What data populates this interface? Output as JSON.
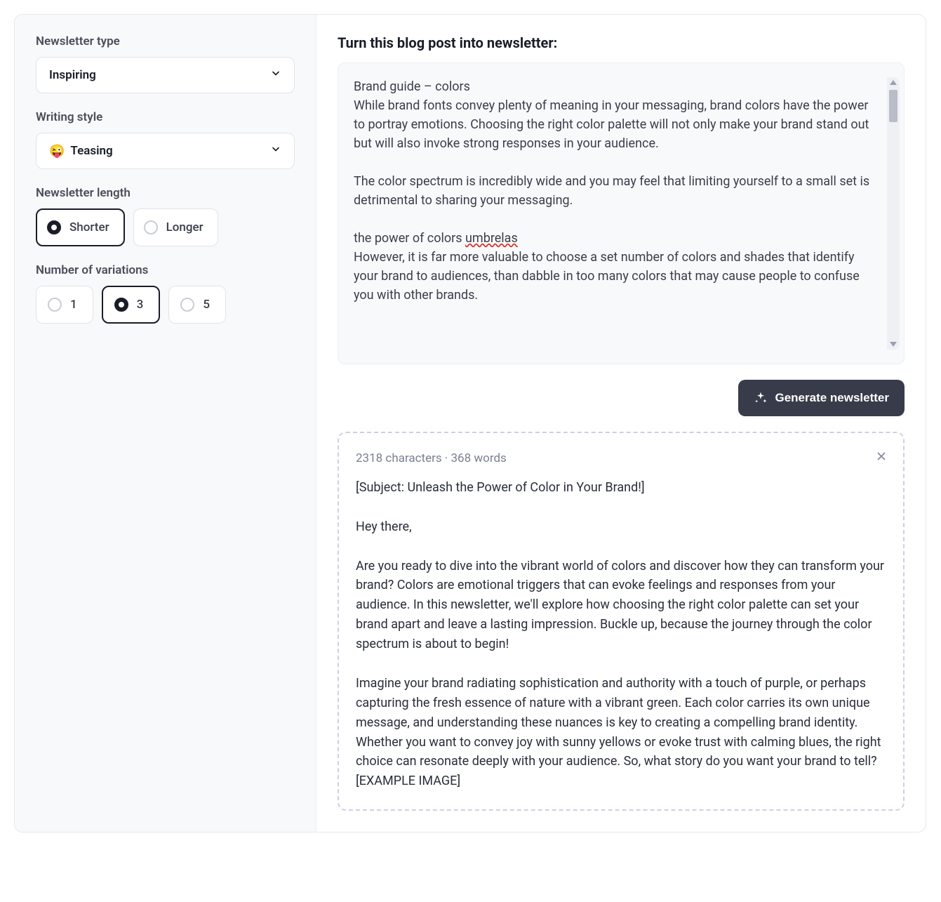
{
  "sidebar": {
    "type_label": "Newsletter type",
    "type_value": "Inspiring",
    "style_label": "Writing style",
    "style_emoji": "😜",
    "style_value": "Teasing",
    "length_label": "Newsletter length",
    "length_options": [
      "Shorter",
      "Longer"
    ],
    "length_selected": "Shorter",
    "variations_label": "Number of variations",
    "variations_options": [
      "1",
      "3",
      "5"
    ],
    "variations_selected": "3"
  },
  "main": {
    "title": "Turn this blog post into newsletter:",
    "input_text_pre": "Brand guide – colors\nWhile brand fonts convey plenty of meaning in your messaging, brand colors have the power to portray emotions. Choosing the right color palette will not only make your brand stand out but will also invoke strong responses in your audience.\n\nThe color spectrum is incredibly wide and you may feel that limiting yourself to a small set is detrimental to sharing your messaging.\n\nthe power of colors ",
    "input_spellerr": "umbrelas",
    "input_text_post": "\nHowever, it is far more valuable to choose a set number of colors and shades that identify your brand to audiences, than dabble in too many colors that may cause people to confuse you with other brands.",
    "generate_label": "Generate newsletter"
  },
  "output": {
    "meta": "2318 characters · 368 words",
    "body": "[Subject: Unleash the Power of Color in Your Brand!]\n\nHey there,\n\nAre you ready to dive into the vibrant world of colors and discover how they can transform your brand? Colors are emotional triggers that can evoke feelings and responses from your audience. In this newsletter, we'll explore how choosing the right color palette can set your brand apart and leave a lasting impression. Buckle up, because the journey through the color spectrum is about to begin!\n\nImagine your brand radiating sophistication and authority with a touch of purple, or perhaps capturing the fresh essence of nature with a vibrant green. Each color carries its own unique message, and understanding these nuances is key to creating a compelling brand identity. Whether you want to convey joy with sunny yellows or evoke trust with calming blues, the right choice can resonate deeply with your audience. So, what story do you want your brand to tell? [EXAMPLE IMAGE]"
  }
}
